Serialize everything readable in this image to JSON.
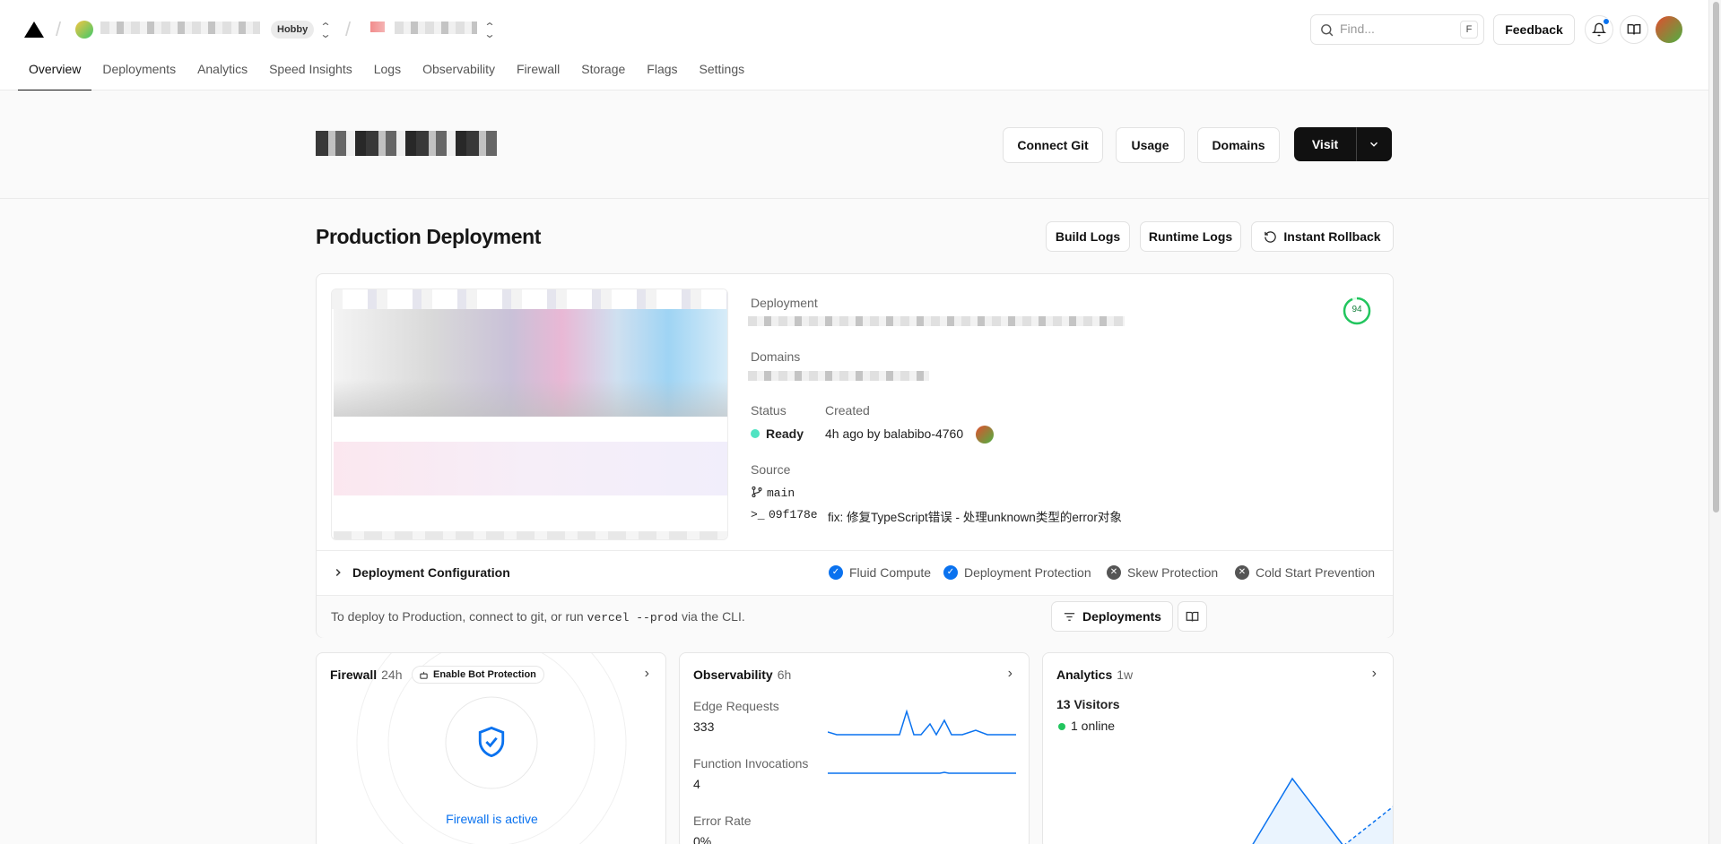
{
  "header": {
    "plan_badge": "Hobby",
    "find_placeholder": "Find...",
    "find_shortcut": "F",
    "feedback_label": "Feedback"
  },
  "nav": {
    "tabs": [
      "Overview",
      "Deployments",
      "Analytics",
      "Speed Insights",
      "Logs",
      "Observability",
      "Firewall",
      "Storage",
      "Flags",
      "Settings"
    ]
  },
  "project": {
    "buttons": {
      "connect_git": "Connect Git",
      "usage": "Usage",
      "domains": "Domains",
      "visit": "Visit"
    }
  },
  "production": {
    "title": "Production Deployment",
    "buttons": {
      "build_logs": "Build Logs",
      "runtime_logs": "Runtime Logs",
      "instant_rollback": "Instant Rollback"
    },
    "deployment_label": "Deployment",
    "domains_label": "Domains",
    "status_label": "Status",
    "status_value": "Ready",
    "created_label": "Created",
    "created_value": "4h ago by balabibo-4760",
    "source_label": "Source",
    "branch": "main",
    "commit_prompt": ">_",
    "commit_hash": "09f178e",
    "commit_message": "fix: 修复TypeScript错误 - 处理unknown类型的error对象",
    "score": "94",
    "config_label": "Deployment Configuration",
    "features": [
      {
        "label": "Fluid Compute",
        "enabled": true
      },
      {
        "label": "Deployment Protection",
        "enabled": true
      },
      {
        "label": "Skew Protection",
        "enabled": false
      },
      {
        "label": "Cold Start Prevention",
        "enabled": false
      }
    ],
    "cli_hint_pre": "To deploy to Production, connect to git, or run",
    "cli_command": "vercel --prod",
    "cli_hint_post": "via the CLI.",
    "deployments_button": "Deployments"
  },
  "firewall": {
    "title": "Firewall",
    "period": "24h",
    "bot_button": "Enable Bot Protection",
    "status": "Firewall is active"
  },
  "observability": {
    "title": "Observability",
    "period": "6h",
    "metrics": [
      {
        "label": "Edge Requests",
        "value": "333"
      },
      {
        "label": "Function Invocations",
        "value": "4"
      },
      {
        "label": "Error Rate",
        "value": "0%"
      }
    ]
  },
  "analytics": {
    "title": "Analytics",
    "period": "1w",
    "visitors": "13 Visitors",
    "online": "1 online"
  },
  "colors": {
    "accent": "#0a72ef",
    "ready": "#50e3c2",
    "online": "#22c55e",
    "score_ring": "#22c55e"
  }
}
